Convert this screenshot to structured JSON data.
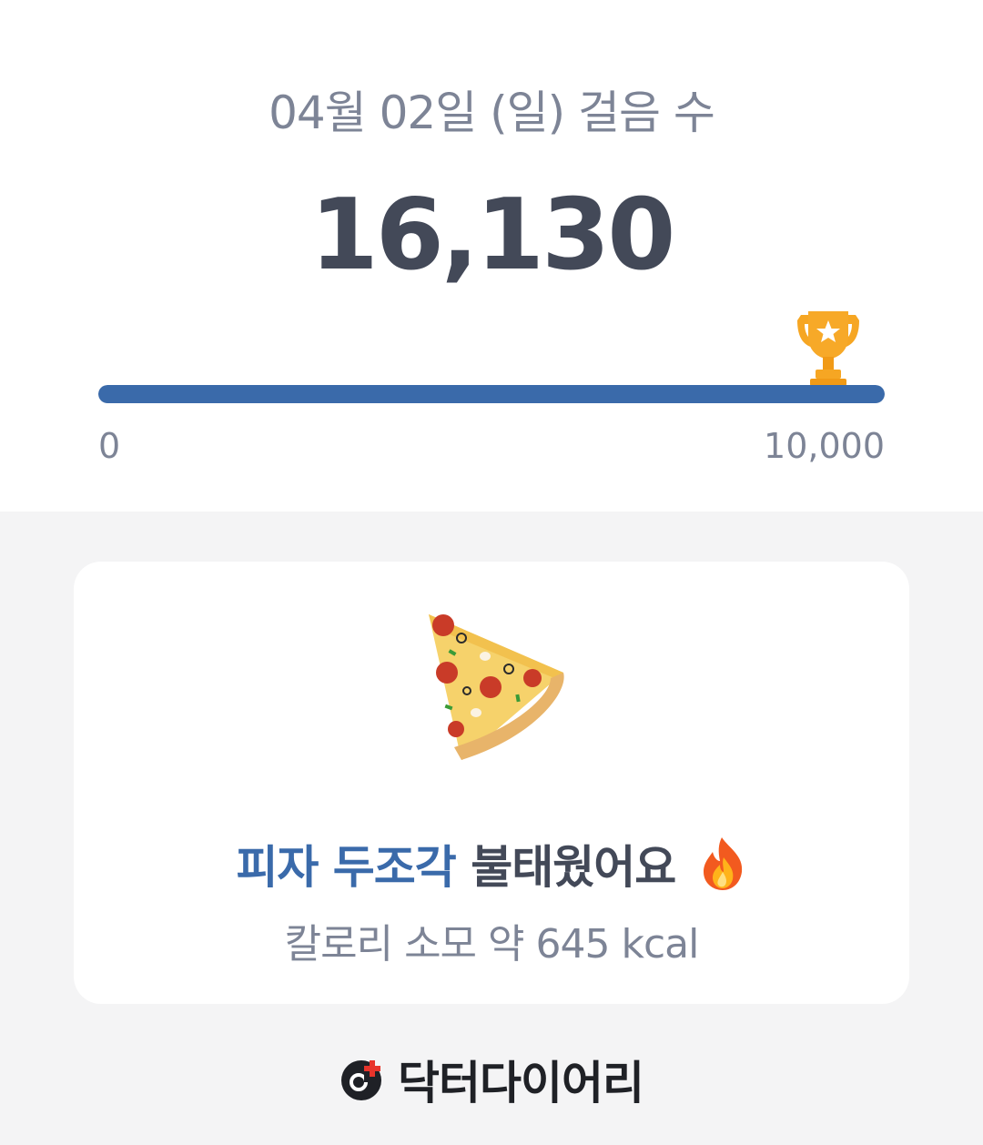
{
  "header": {
    "date_title": "04월 02일 (일) 걸음 수",
    "steps": "16,130"
  },
  "progress": {
    "min_label": "0",
    "goal_label": "10,000",
    "fraction": 1.0,
    "icon": "trophy-icon",
    "color": "#3a6aaa"
  },
  "card": {
    "food_icon": "pizza-icon",
    "burn_food": "피자 두조각",
    "burn_suffix": "불태웠어요",
    "burn_icon": "fire-icon",
    "calorie_text": "칼로리 소모 약 645 kcal"
  },
  "brand": {
    "logo_icon": "doctor-diary-logo-icon",
    "name": "닥터다이어리"
  }
}
